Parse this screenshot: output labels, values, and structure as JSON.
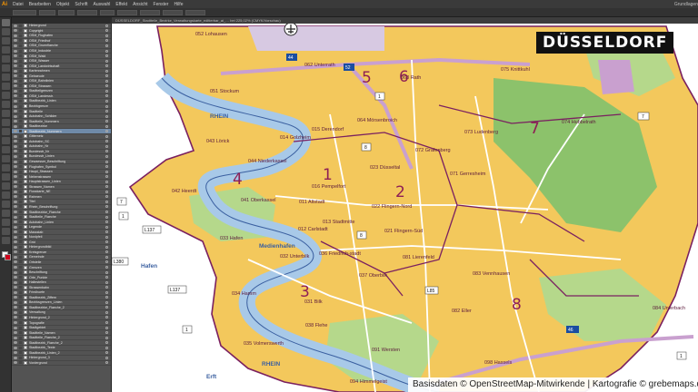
{
  "app": {
    "logo": "Ai",
    "menu": [
      "Datei",
      "Bearbeiten",
      "Objekt",
      "Schrift",
      "Auswahl",
      "Effekt",
      "Ansicht",
      "Fenster",
      "Hilfe"
    ],
    "workspace": "Grundlagen"
  },
  "document": {
    "tab_title": "DÜSSELDORF_Stadtteile_Bezirke_Verwaltungskarte_editierbar_ai_… bei 225,02% (CMYK/Vorschau)",
    "zoom": "225,02%"
  },
  "layers": [
    "Hintergrund",
    "Copyright",
    "OSM_Flughafen",
    "OSM_Friedhof",
    "OSM_Gruenflaeche",
    "OSM_Industrie",
    "OSM_Wald",
    "OSM_Wasser",
    "OSM_Landwirtschaft",
    "Kartenrahmen",
    "Gebaeude",
    "OSM_Bahnlinien",
    "OSM_Strassen",
    "Stadtteilgrenzen",
    "OSM_Landesstr.",
    "Stadtbezirk_Linien",
    "Bezirkgrenze",
    "Stadtteile",
    "Autobahn_Schilder",
    "Stadtteile_Nummern",
    "Stadtbezirke",
    "Stadtbezirk_Nummern",
    "Gitternetz",
    "Autobahn_SC",
    "Autobahn_Nr",
    "Bundesstr_Nr",
    "Bundesstr_Linien",
    "Gewaesser_Beschriftung",
    "Flughafen_Symbol",
    "Haupt_Strassen",
    "Nebenstrassen",
    "Hauptstrassen_Linien",
    "Strassen_Namen",
    "Flusskarte_NE",
    "Rahmen",
    "Titel",
    "Rhein_Beschriftung",
    "Stadtbezirke_Flaeche",
    "Stadtteile_Flaeche",
    "Autobahn_Linien",
    "Legende",
    "Massstab",
    "Nordpfeil",
    "Grid",
    "Hintergrundbild",
    "Kreisgrenze",
    "Gemeinde",
    "Ortsteile",
    "Grenzen",
    "Beschriftung",
    "Orte_Punkte",
    "Haltestellen",
    "Strassenbahn",
    "Friedhoefe",
    "Stadtbezirk_Ziffern",
    "Bezirksgrenzen_Linien",
    "Stadtbezirke_Flaeche_2",
    "Verwaltung",
    "Hintergrund_2",
    "Topografie",
    "Stadtgebiet",
    "Stadtteile_Namen",
    "Stadtteile_Flaeche_2",
    "Stadtbezirk_Flaeche_2",
    "Stadtbezirk_Texte",
    "Stadtbezirk_Linien_2",
    "Hintergrund_3",
    "Vordergrund"
  ],
  "map": {
    "title": "DÜSSELDORF",
    "credits": "Basisdaten © OpenStreetMap-Mitwirkende | Kartografie © grebemaps.de",
    "colors": {
      "built": "#f3c85c",
      "green": "#b5d88b",
      "forest": "#8cc26b",
      "water": "#a8c9e8",
      "outside": "#ffffff",
      "border": "#7a2060",
      "motorway": "#c9a0cf",
      "road": "#ffffff"
    },
    "districts": [
      {
        "num": "1"
      },
      {
        "num": "2"
      },
      {
        "num": "3"
      },
      {
        "num": "4"
      },
      {
        "num": "5"
      },
      {
        "num": "6"
      },
      {
        "num": "7"
      },
      {
        "num": "8"
      }
    ],
    "quarters": [
      {
        "label": "052 Lohausen"
      },
      {
        "label": "062 Unterrath"
      },
      {
        "label": "063 Rath"
      },
      {
        "label": "075 Knittkuhl"
      },
      {
        "label": "051 Stockum"
      },
      {
        "label": "064 Mörsenbroich"
      },
      {
        "label": "074 Hubbelrath"
      },
      {
        "label": "015 Derendorf"
      },
      {
        "label": "043 Lörick"
      },
      {
        "label": "014 Golzheim"
      },
      {
        "label": "073 Ludenberg"
      },
      {
        "label": "044 Niederkassel"
      },
      {
        "label": "023 Düsseltal"
      },
      {
        "label": "072 Grafenberg"
      },
      {
        "label": "016 Pempelfort"
      },
      {
        "label": "042 Heerdt"
      },
      {
        "label": "071 Gerresheim"
      },
      {
        "label": "041 Oberkassel"
      },
      {
        "label": "022 Flingern-Nord"
      },
      {
        "label": "011 Altstadt"
      },
      {
        "label": "013 Stadtmitte"
      },
      {
        "label": "012 Carlstadt"
      },
      {
        "label": "021 Flingern-Süd"
      },
      {
        "label": "033 Hafen"
      },
      {
        "label": "036 Friedrich-stadt"
      },
      {
        "label": "032 Unterbilk"
      },
      {
        "label": "081 Lierenfeld"
      },
      {
        "label": "037 Oberbilk"
      },
      {
        "label": "083 Vennhausen"
      },
      {
        "label": "034 Hamm"
      },
      {
        "label": "031 Bilk"
      },
      {
        "label": "082 Eller"
      },
      {
        "label": "084 Unterbach"
      },
      {
        "label": "038 Flehe"
      },
      {
        "label": "035 Volmerswerth"
      },
      {
        "label": "091 Wersten"
      },
      {
        "label": "098 Hassels"
      },
      {
        "label": "094 Himmelgeist"
      }
    ],
    "water_labels": [
      {
        "text": "RHEIN"
      },
      {
        "text": "RHEIN"
      },
      {
        "text": "Medienhafen"
      },
      {
        "text": "Hafen"
      },
      {
        "text": "Erft"
      }
    ],
    "road_shields": [
      {
        "text": "44"
      },
      {
        "text": "52"
      },
      {
        "text": "7"
      },
      {
        "text": "1"
      },
      {
        "text": "8"
      },
      {
        "text": "8"
      },
      {
        "text": "7"
      },
      {
        "text": "1"
      },
      {
        "text": "L137"
      },
      {
        "text": "L137"
      },
      {
        "text": "L380"
      },
      {
        "text": "L85"
      },
      {
        "text": "1"
      },
      {
        "text": "46"
      },
      {
        "text": "1"
      }
    ]
  }
}
